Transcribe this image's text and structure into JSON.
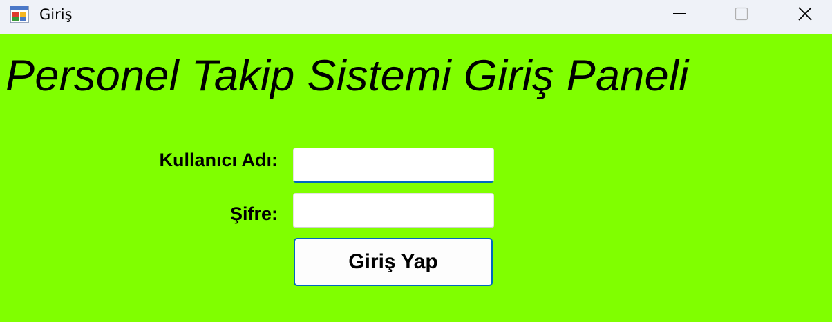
{
  "window": {
    "title": "Giriş",
    "icon": "app-form-icon",
    "controls": [
      "minimize-icon",
      "maximize-icon",
      "close-icon"
    ]
  },
  "form": {
    "heading": "Personel Takip Sistemi Giriş Paneli",
    "username_label": "Kullanıcı Adı:",
    "username_value": "",
    "password_label": "Şifre:",
    "password_value": "",
    "login_button": "Giriş Yap"
  },
  "colors": {
    "background": "#80ff00",
    "accent": "#0067c0",
    "titlebar": "#eff2f8"
  }
}
